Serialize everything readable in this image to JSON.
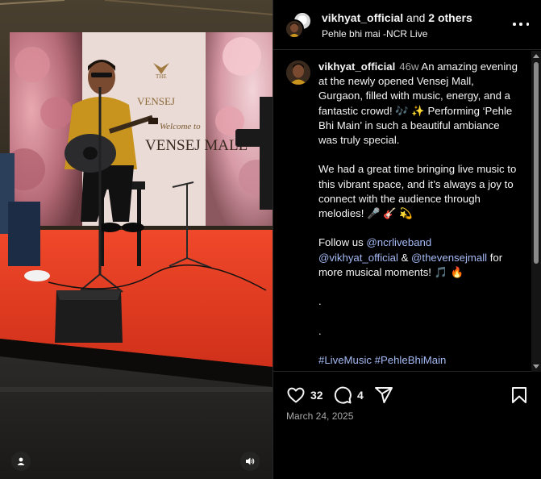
{
  "header": {
    "username": "vikhyat_official",
    "and_text": "and",
    "others": "2 others",
    "subtitle": "Pehle bhi mai -NCR Live"
  },
  "caption": {
    "username": "vikhyat_official",
    "time": "46w",
    "para1": "An amazing evening at the newly opened Vensej Mall, Gurgaon, filled with music, energy, and a fantastic crowd! 🎶 ✨ Performing ‘Pehle Bhi Main’ in such a beautiful ambiance was truly special.",
    "para2": "We had a great time bringing live music to this vibrant space, and it’s always a joy to connect with the audience through melodies! 🎤 🎸 💫",
    "follow_prefix": "Follow us",
    "mention_band": "@ncrliveband",
    "mention_artist": "@vikhyat_official",
    "amp": "&",
    "mention_mall": "@thevensejmall",
    "follow_suffix": "for more musical moments! 🎵 🔥",
    "dot1": ".",
    "dot2": ".",
    "hashtags": "#LiveMusic #PehleBhiMain"
  },
  "actions": {
    "likes": "32",
    "comments": "4"
  },
  "date": "March 24, 2025",
  "backdrop": {
    "line1": "THE",
    "line2": "VENSEJ",
    "line3": "Welcome to",
    "line4": "VENSEJ MALL"
  },
  "icons": {
    "like": "heart-icon",
    "comment": "comment-bubble-icon",
    "share": "paper-plane-icon",
    "save": "bookmark-icon",
    "more": "more-options-icon",
    "tags": "user-tag-icon",
    "audio": "speaker-icon"
  },
  "colors": {
    "link": "#a4baf5",
    "muted": "#a8a8a8",
    "stage": "#e2361b",
    "background": "#000000"
  }
}
